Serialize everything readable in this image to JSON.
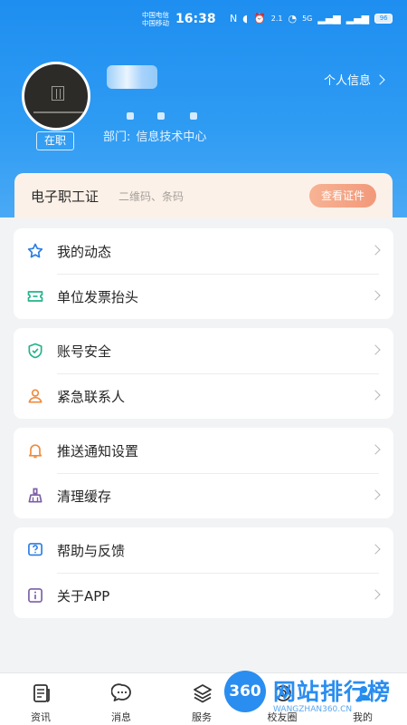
{
  "status_bar": {
    "carrier_1": "中国电信",
    "carrier_2": "中国移动",
    "time": "16:38",
    "network": "5G",
    "battery": "96"
  },
  "profile": {
    "employment_status": "在职",
    "department_label": "部门:",
    "department_value": "信息技术中心",
    "personal_info_link": "个人信息"
  },
  "id_card": {
    "title": "电子职工证",
    "subtitle": "二维码、条码",
    "button": "查看证件"
  },
  "menu_groups": [
    {
      "items": [
        {
          "label": "我的动态",
          "icon": "star-icon"
        },
        {
          "label": "单位发票抬头",
          "icon": "ticket-icon"
        }
      ]
    },
    {
      "items": [
        {
          "label": "账号安全",
          "icon": "shield-check-icon"
        },
        {
          "label": "紧急联系人",
          "icon": "contact-person-icon"
        }
      ]
    },
    {
      "items": [
        {
          "label": "推送通知设置",
          "icon": "bell-icon"
        },
        {
          "label": "清理缓存",
          "icon": "broom-icon"
        }
      ]
    },
    {
      "items": [
        {
          "label": "帮助与反馈",
          "icon": "help-question-icon"
        },
        {
          "label": "关于APP",
          "icon": "info-icon"
        }
      ]
    }
  ],
  "tabbar": {
    "tabs": [
      {
        "label": "资讯",
        "icon": "news-icon"
      },
      {
        "label": "消息",
        "icon": "chat-bubble-icon"
      },
      {
        "label": "服务",
        "icon": "layers-icon"
      },
      {
        "label": "校友圈",
        "icon": "alumni-icon"
      },
      {
        "label": "我的",
        "icon": "profile-icon"
      }
    ]
  },
  "watermark": {
    "logo": "360",
    "text": "网站排行榜",
    "sub": "WANGZHAN360.CN"
  },
  "colors": {
    "header_blue": "#1e8ef0",
    "id_card_bg": "#fcf1e8",
    "view_cert_button": "#f2997a",
    "icon_blue": "#2b7de3",
    "icon_green": "#22b38a",
    "icon_orange": "#f08a3c",
    "icon_purple": "#7b5ea8"
  }
}
